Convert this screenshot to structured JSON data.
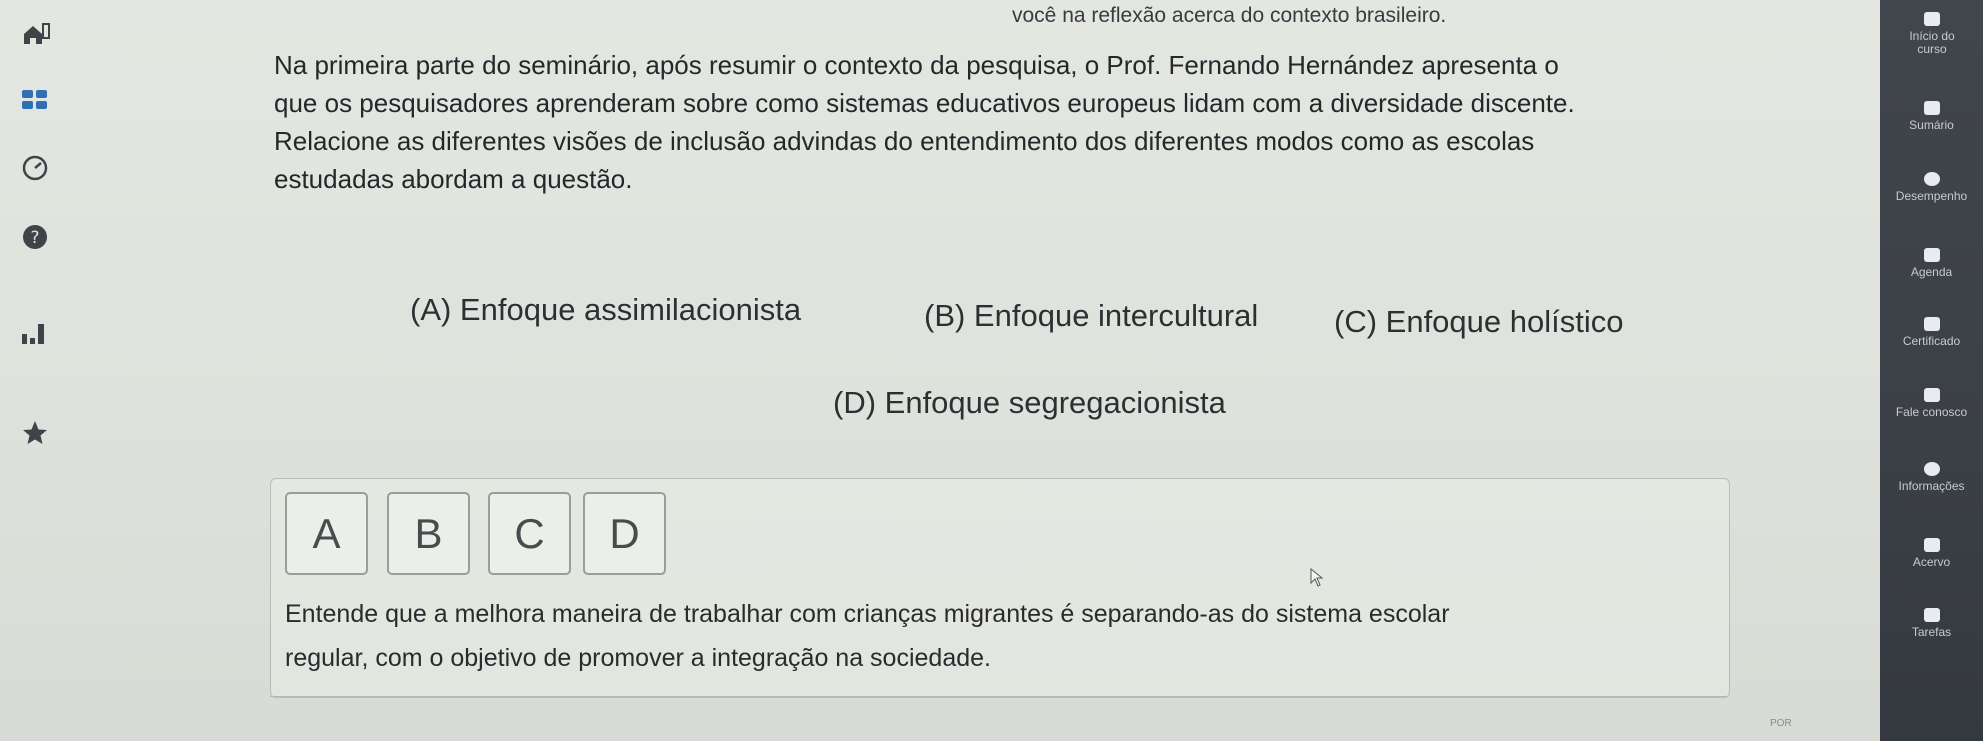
{
  "header": {
    "text": "você na reflexão acerca do contexto brasileiro."
  },
  "question": {
    "lines": [
      "Na primeira parte do seminário, após resumir o contexto da pesquisa, o Prof. Fernando Hernández apresenta o",
      "que os pesquisadores aprenderam sobre como sistemas educativos europeus lidam com a diversidade discente.",
      "Relacione as diferentes visões de inclusão advindas do entendimento dos diferentes modos como as escolas",
      "estudadas abordam a questão."
    ]
  },
  "options": {
    "a": "(A) Enfoque assimilacionista",
    "b": "(B) Enfoque intercultural",
    "c": "(C) Enfoque holístico",
    "d": "(D) Enfoque segregacionista"
  },
  "answer_buttons": [
    "A",
    "B",
    "C",
    "D"
  ],
  "feedback": {
    "lines": [
      "Entende que a melhora maneira de trabalhar com crianças migrantes é separando-as do sistema escolar",
      "regular, com o objetivo de promover a integração na sociedade."
    ]
  },
  "sidebar": {
    "items": [
      {
        "label": "Início do curso",
        "icon": "home-icon"
      },
      {
        "label": "Sumário",
        "icon": "list-icon"
      },
      {
        "label": "Desempenho",
        "icon": "performance-icon"
      },
      {
        "label": "Agenda",
        "icon": "calendar-icon"
      },
      {
        "label": "Certificado",
        "icon": "certificate-icon"
      },
      {
        "label": "Fale conosco",
        "icon": "chat-icon"
      },
      {
        "label": "Informações",
        "icon": "info-icon"
      },
      {
        "label": "Acervo",
        "icon": "library-icon"
      },
      {
        "label": "Tarefas",
        "icon": "tasks-icon"
      }
    ]
  },
  "left_rail": {
    "icons": [
      "home-icon",
      "grid-icon",
      "clock-icon",
      "help-icon",
      "chart-icon",
      "star-icon"
    ]
  },
  "taskbar": {
    "lang": "POR"
  },
  "colors": {
    "sidebar_bg": "#3b4046",
    "page_bg": "#e0e3dd",
    "text": "#26272a"
  }
}
